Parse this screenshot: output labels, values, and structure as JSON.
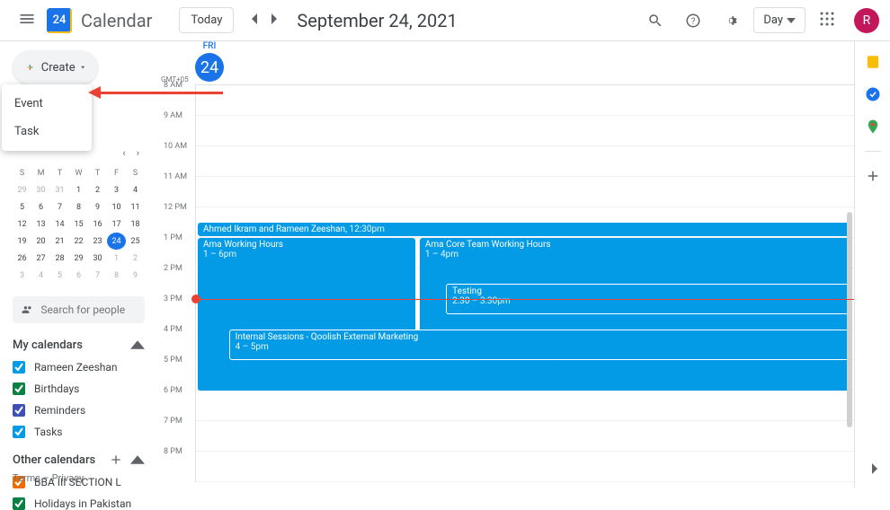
{
  "header": {
    "app_name": "Calendar",
    "logo_day": "24",
    "today_label": "Today",
    "date_title": "September 24, 2021",
    "view_label": "Day",
    "avatar_letter": "R"
  },
  "create": {
    "label": "Create",
    "menu": {
      "event": "Event",
      "task": "Task"
    }
  },
  "mini_cal": {
    "dow": [
      "S",
      "M",
      "T",
      "W",
      "T",
      "F",
      "S"
    ],
    "rows": [
      [
        "29",
        "30",
        "31",
        "1",
        "2",
        "3",
        "4"
      ],
      [
        "5",
        "6",
        "7",
        "8",
        "9",
        "10",
        "11"
      ],
      [
        "12",
        "13",
        "14",
        "15",
        "16",
        "17",
        "18"
      ],
      [
        "19",
        "20",
        "21",
        "22",
        "23",
        "24",
        "25"
      ],
      [
        "26",
        "27",
        "28",
        "29",
        "30",
        "1",
        "2"
      ],
      [
        "3",
        "4",
        "5",
        "6",
        "7",
        "8",
        "9"
      ]
    ],
    "today": "24"
  },
  "search_people_placeholder": "Search for people",
  "my_calendars": {
    "title": "My calendars",
    "items": [
      {
        "label": "Rameen Zeeshan",
        "color": "#039be5"
      },
      {
        "label": "Birthdays",
        "color": "#0b8043"
      },
      {
        "label": "Reminders",
        "color": "#3f51b5"
      },
      {
        "label": "Tasks",
        "color": "#039be5"
      }
    ]
  },
  "other_calendars": {
    "title": "Other calendars",
    "items": [
      {
        "label": "BBA III SECTION L",
        "color": "#ef6c00"
      },
      {
        "label": "Holidays in Pakistan",
        "color": "#0b8043"
      }
    ]
  },
  "footer": {
    "terms": "Terms",
    "privacy": "Privacy"
  },
  "day": {
    "tz": "GMT+05",
    "label": "FRI",
    "num": "24",
    "hours": [
      "8 AM",
      "9 AM",
      "10 AM",
      "11 AM",
      "12 PM",
      "1 PM",
      "2 PM",
      "3 PM",
      "4 PM",
      "5 PM",
      "6 PM",
      "7 PM",
      "8 PM"
    ]
  },
  "events": {
    "e1": {
      "title": "Ahmed Ikram and Rameen Zeeshan,",
      "time": "12:30pm"
    },
    "e2": {
      "title": "Ama Working Hours",
      "time": "1 – 6pm"
    },
    "e3": {
      "title": "Ama Core Team Working Hours",
      "time": "1 – 4pm"
    },
    "e4": {
      "title": "Testing",
      "time": "2:30 – 3:30pm"
    },
    "e5": {
      "title": "Internal Sessions - Qoolish External Marketing",
      "time": "4 – 5pm"
    }
  }
}
